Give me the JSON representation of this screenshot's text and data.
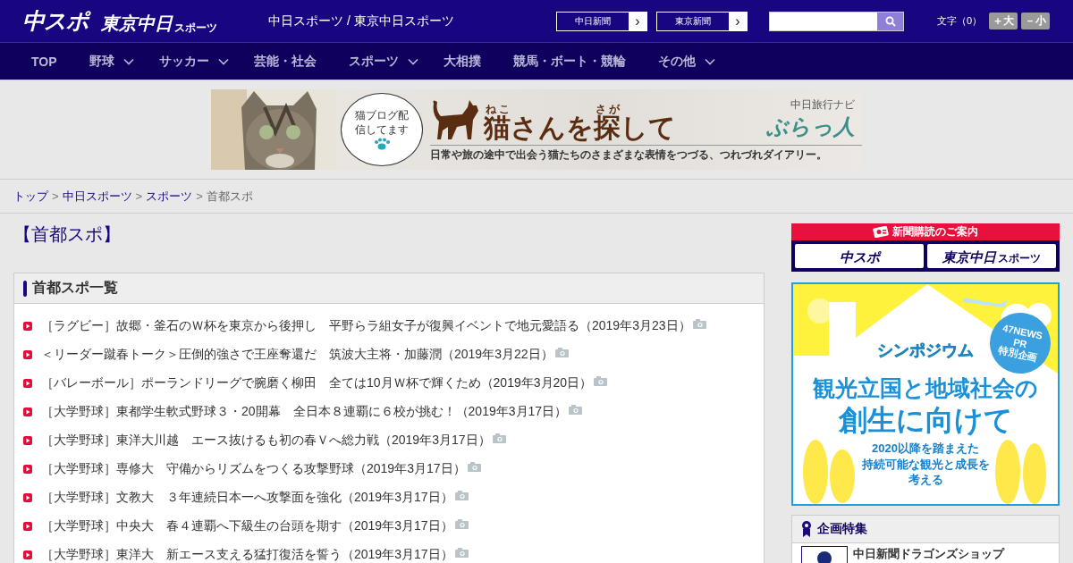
{
  "header": {
    "logo_main": "中スポ",
    "logo_second": {
      "main": "東京中日",
      "sub": "スポーツ"
    },
    "tagline": "中日スポーツ / 東京中日スポーツ",
    "site_buttons": [
      {
        "label": "中日新聞",
        "arrow": "›"
      },
      {
        "label": "東京新聞",
        "arrow": "›"
      }
    ],
    "font_size": {
      "label": "文字（0）",
      "buttons": [
        {
          "label": "＋大"
        },
        {
          "label": "－小"
        }
      ]
    }
  },
  "nav": [
    {
      "label": "TOP",
      "has_menu": false
    },
    {
      "label": "野球",
      "has_menu": true
    },
    {
      "label": "サッカー",
      "has_menu": true
    },
    {
      "label": "芸能・社会",
      "has_menu": false
    },
    {
      "label": "スポーツ",
      "has_menu": true
    },
    {
      "label": "大相撲",
      "has_menu": false
    },
    {
      "label": "競馬・ボート・競輪",
      "has_menu": false
    },
    {
      "label": "その他",
      "has_menu": true
    }
  ],
  "banner": {
    "kind": "picture",
    "bubble": "猫ブログ配信してます",
    "title": [
      {
        "text": "猫",
        "ruby": "ねこ"
      },
      {
        "text": "さんを"
      },
      {
        "text": "探",
        "ruby": "さが"
      },
      {
        "text": "して"
      }
    ],
    "subtitle": "日常や旅の途中で出会う猫たちのさまざまな表情をつづる、つれづれダイアリー。",
    "brand_small": "中日旅行ナビ",
    "brand": "ぶらっ人"
  },
  "breadcrumb": {
    "separator": ">",
    "items": [
      {
        "label": "トップ",
        "link": true
      },
      {
        "label": "中日スポーツ",
        "link": true
      },
      {
        "label": "スポーツ",
        "link": true
      },
      {
        "label": "首都スポ",
        "link": false
      }
    ]
  },
  "page_title": "【首都スポ】",
  "article_list": {
    "title": "首都スポ一覧",
    "items": [
      {
        "text": "［ラグビー］故郷・釜石のＷ杯を東京から後押し　平野らラ組女子が復興イベントで地元愛語る（2019年3月23日）",
        "photo": true
      },
      {
        "text": "＜リーダー蹴春トーク＞圧倒的強さで王座奪還だ　筑波大主将・加藤潤（2019年3月22日）",
        "photo": true
      },
      {
        "text": "［バレーボール］ポーランドリーグで腕磨く柳田　全ては10月Ｗ杯で輝くため（2019年3月20日）",
        "photo": true
      },
      {
        "text": "［大学野球］東都学生軟式野球３・20開幕　全日本８連覇に６校が挑む！（2019年3月17日）",
        "photo": true
      },
      {
        "text": "［大学野球］東洋大川越　エース抜けるも初の春Ｖへ総力戦（2019年3月17日）",
        "photo": true
      },
      {
        "text": "［大学野球］専修大　守備からリズムをつくる攻撃野球（2019年3月17日）",
        "photo": true
      },
      {
        "text": "［大学野球］文教大　３年連続日本一へ攻撃面を強化（2019年3月17日）",
        "photo": true
      },
      {
        "text": "［大学野球］中央大　春４連覇へ下級生の台頭を期す（2019年3月17日）",
        "photo": true
      },
      {
        "text": "［大学野球］東洋大　新エース支える猛打復活を誓う（2019年3月17日）",
        "photo": true
      }
    ]
  },
  "subscription": {
    "title": "新聞購読のご案内",
    "buttons": [
      {
        "main": "中スポ"
      },
      {
        "main": "東京中日",
        "sub": "スポーツ"
      }
    ]
  },
  "ad": {
    "badge": [
      "47NEWS",
      "PR",
      "特別企画"
    ],
    "kicker": "シンポジウム",
    "headline": [
      "観光立国と地域社会の",
      "創生に向けて"
    ],
    "body": [
      "2020以降を踏まえた",
      "持続可能な観光と成長を",
      "考える"
    ]
  },
  "features": {
    "title": "企画特集",
    "items": [
      {
        "text": "中日新聞ドラゴンズショップ"
      }
    ]
  }
}
